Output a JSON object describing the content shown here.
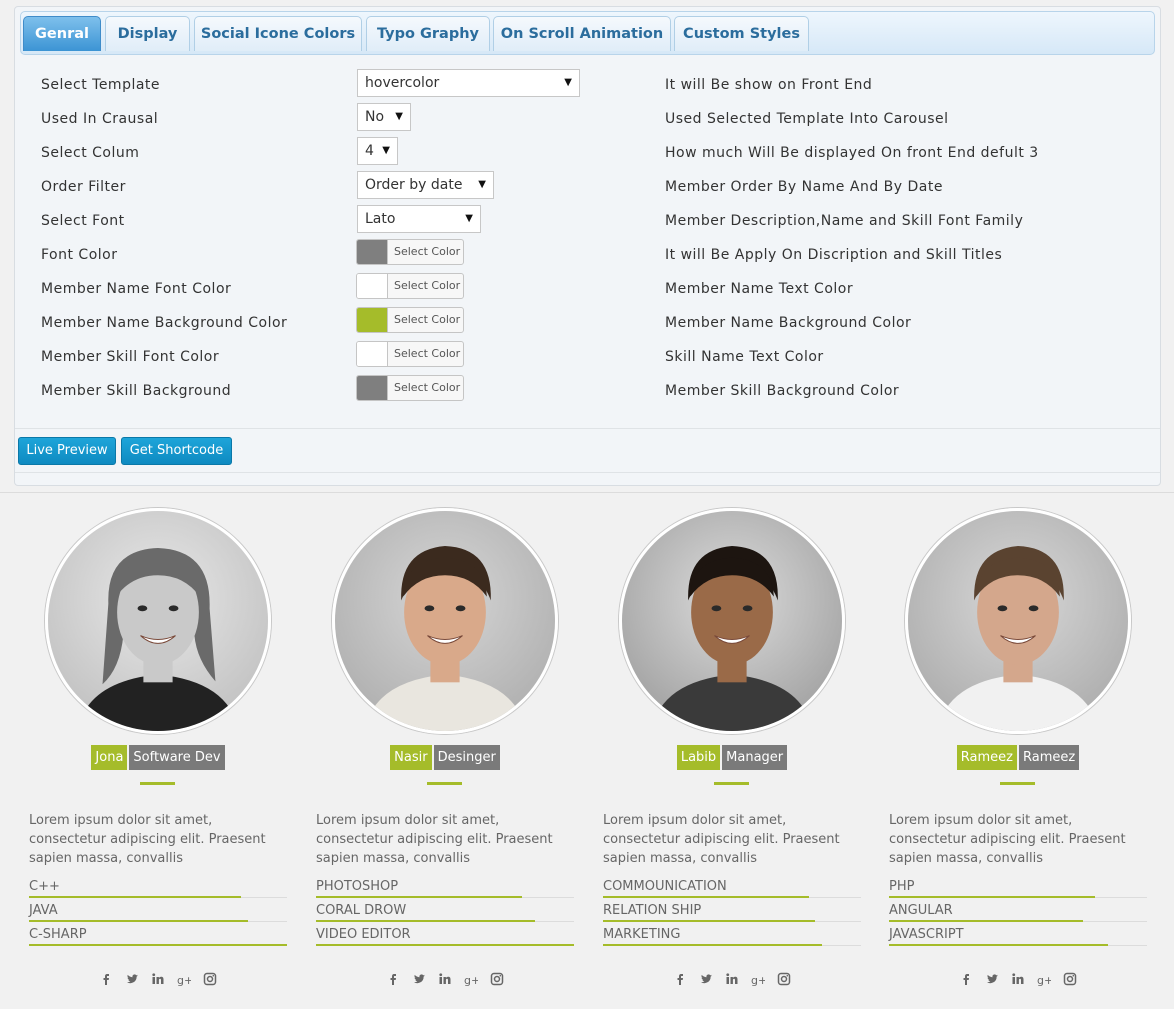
{
  "tabs": [
    "Genral",
    "Display",
    "Social Icone Colors",
    "Typo Graphy",
    "On Scroll Animation",
    "Custom Styles"
  ],
  "settings": [
    {
      "label": "Select Template",
      "value": "hovercolor",
      "desc": "It will Be show on Front End"
    },
    {
      "label": "Used In Crausal",
      "value": "No",
      "desc": "Used Selected Template Into Carousel"
    },
    {
      "label": "Select Colum",
      "value": "4",
      "desc": "How much Will Be displayed On front End defult 3"
    },
    {
      "label": "Order Filter",
      "value": "Order by date",
      "desc": "Member Order By Name And By Date"
    },
    {
      "label": "Select Font",
      "value": "Lato",
      "desc": "Member Description,Name and Skill Font Family"
    },
    {
      "label": "Font Color",
      "button": "Select Color",
      "color": "#7f7f7f",
      "desc": "It will Be Apply On Discription and Skill Titles"
    },
    {
      "label": "Member Name Font Color",
      "button": "Select Color",
      "color": "#ffffff",
      "desc": "Member Name Text Color"
    },
    {
      "label": "Member Name Background Color",
      "button": "Select Color",
      "color": "#a5bc2a",
      "desc": "Member Name Background Color"
    },
    {
      "label": "Member Skill Font Color",
      "button": "Select Color",
      "color": "#ffffff",
      "desc": "Skill Name Text Color"
    },
    {
      "label": "Member Skill Background",
      "button": "Select Color",
      "color": "#7f7f7f",
      "desc": "Member Skill Background Color"
    }
  ],
  "buttons": {
    "live_preview": "Live Preview",
    "get_shortcode": "Get Shortcode"
  },
  "members": [
    {
      "name": "Jona",
      "role": "Software Dev",
      "bio": "Lorem ipsum dolor sit amet, consectetur adipiscing elit. Praesent sapien massa, convallis",
      "skills": [
        {
          "name": "C++",
          "level": 0.82
        },
        {
          "name": "JAVA",
          "level": 0.85
        },
        {
          "name": "C-SHARP",
          "level": 1.0
        }
      ]
    },
    {
      "name": "Nasir",
      "role": "Desinger",
      "bio": "Lorem ipsum dolor sit amet, consectetur adipiscing elit. Praesent sapien massa, convallis",
      "skills": [
        {
          "name": "PHOTOSHOP",
          "level": 0.8
        },
        {
          "name": "CORAL DROW",
          "level": 0.85
        },
        {
          "name": "VIDEO EDITOR",
          "level": 1.0
        }
      ]
    },
    {
      "name": "Labib",
      "role": "Manager",
      "bio": "Lorem ipsum dolor sit amet, consectetur adipiscing elit. Praesent sapien massa, convallis",
      "skills": [
        {
          "name": "COMMOUNICATION",
          "level": 0.8
        },
        {
          "name": "RELATION SHIP",
          "level": 0.82
        },
        {
          "name": "MARKETING",
          "level": 0.85
        }
      ]
    },
    {
      "name": "Rameez",
      "role": "Rameez",
      "bio": "Lorem ipsum dolor sit amet, consectetur adipiscing elit. Praesent sapien massa, convallis",
      "skills": [
        {
          "name": "PHP",
          "level": 0.8
        },
        {
          "name": "ANGULAR",
          "level": 0.75
        },
        {
          "name": "JAVASCRIPT",
          "level": 0.85
        }
      ]
    }
  ],
  "social_icons": [
    "facebook-icon",
    "twitter-icon",
    "linkedin-icon",
    "google-plus-icon",
    "instagram-icon"
  ],
  "colors": {
    "accent": "#a5bc2a",
    "role_bg": "#7a7a7a",
    "button": "#1ea5d9",
    "tab_active": "#3c94d4",
    "tab_text": "#2b6d9d"
  }
}
